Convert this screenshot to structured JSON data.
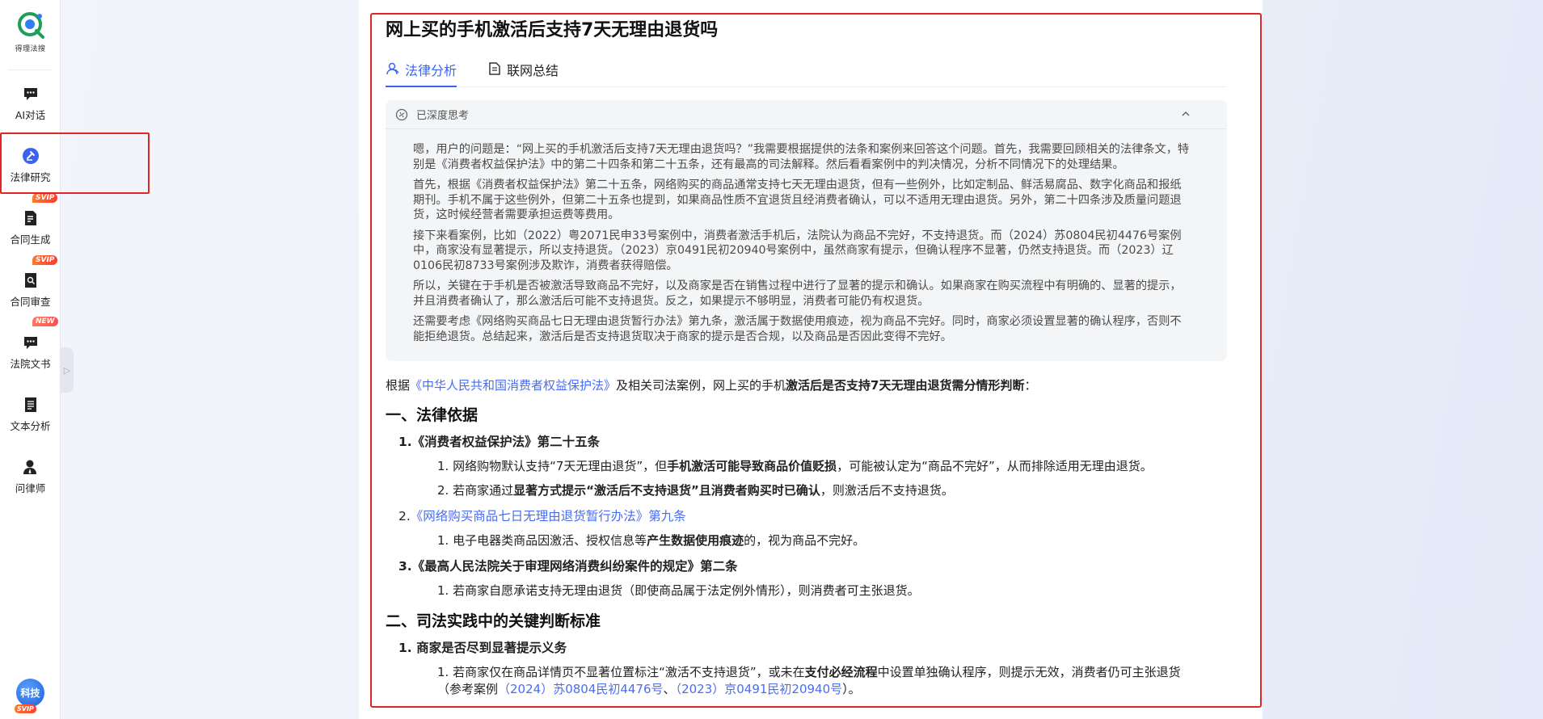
{
  "sidebar": {
    "logo_text": "得理法搜",
    "items": [
      {
        "label": "AI对话",
        "icon": "chat-icon",
        "badge": ""
      },
      {
        "label": "法律研究",
        "icon": "law-research-icon",
        "badge": ""
      },
      {
        "label": "合同生成",
        "icon": "contract-generate-icon",
        "badge": "SVIP"
      },
      {
        "label": "合同审查",
        "icon": "contract-review-icon",
        "badge": "SVIP"
      },
      {
        "label": "法院文书",
        "icon": "court-document-icon",
        "badge": "NEW"
      },
      {
        "label": "文本分析",
        "icon": "text-analysis-icon",
        "badge": ""
      },
      {
        "label": "问律师",
        "icon": "ask-lawyer-icon",
        "badge": ""
      }
    ],
    "avatar_text": "科技",
    "avatar_badge": "SVIP"
  },
  "main": {
    "title": "网上买的手机激活后支持7天无理由退货吗",
    "tabs": [
      {
        "label": "法律分析",
        "active": true
      },
      {
        "label": "联网总结",
        "active": false
      }
    ],
    "thinking": {
      "header": "已深度思考",
      "paragraphs": [
        "嗯，用户的问题是：“网上买的手机激活后支持7天无理由退货吗？”我需要根据提供的法条和案例来回答这个问题。首先，我需要回顾相关的法律条文，特别是《消费者权益保护法》中的第二十四条和第二十五条，还有最高的司法解释。然后看看案例中的判决情况，分析不同情况下的处理结果。",
        "首先，根据《消费者权益保护法》第二十五条，网络购买的商品通常支持七天无理由退货，但有一些例外，比如定制品、鲜活易腐品、数字化商品和报纸期刊。手机不属于这些例外，但第二十五条也提到，如果商品性质不宜退货且经消费者确认，可以不适用无理由退货。另外，第二十四条涉及质量问题退货，这时候经营者需要承担运费等费用。",
        "接下来看案例，比如（2022）粤2071民申33号案例中，消费者激活手机后，法院认为商品不完好，不支持退货。而（2024）苏0804民初4476号案例中，商家没有显著提示，所以支持退货。（2023）京0491民初20940号案例中，虽然商家有提示，但确认程序不显著，仍然支持退货。而（2023）辽0106民初8733号案例涉及欺诈，消费者获得赔偿。",
        "所以，关键在于手机是否被激活导致商品不完好，以及商家是否在销售过程中进行了显著的提示和确认。如果商家在购买流程中有明确的、显著的提示，并且消费者确认了，那么激活后可能不支持退货。反之，如果提示不够明显，消费者可能仍有权退货。",
        "还需要考虑《网络购买商品七日无理由退货暂行办法》第九条，激活属于数据使用痕迹，视为商品不完好。同时，商家必须设置显著的确认程序，否则不能拒绝退货。总结起来，激活后是否支持退货取决于商家的提示是否合规，以及商品是否因此变得不完好。"
      ]
    },
    "answer": {
      "intro_prefix": "根据",
      "intro_link": "《中华人民共和国消费者权益保护法》",
      "intro_mid": "及相关司法案例，网上买的手机",
      "intro_bold": "激活后是否支持7天无理由退货需分情形判断",
      "intro_suffix": "：",
      "section1_title": "一、法律依据",
      "s1_item1_title": "1.《消费者权益保护法》第二十五条",
      "s1_item1_sub1_a": "1. 网络购物默认支持“7天无理由退货”，但",
      "s1_item1_sub1_b": "手机激活可能导致商品价值贬损",
      "s1_item1_sub1_c": "，可能被认定为“商品不完好”，从而排除适用无理由退货。",
      "s1_item1_sub2_a": "2. 若商家通过",
      "s1_item1_sub2_b": "显著方式提示“激活后不支持退货”且消费者购买时已确认",
      "s1_item1_sub2_c": "，则激活后不支持退货。",
      "s1_item2_num": "2.",
      "s1_item2_title": "《网络购买商品七日无理由退货暂行办法》第九条",
      "s1_item2_sub1_a": "1. 电子电器类商品因激活、授权信息等",
      "s1_item2_sub1_b": "产生数据使用痕迹",
      "s1_item2_sub1_c": "的，视为商品不完好。",
      "s1_item3_title": "3.《最高人民法院关于审理网络消费纠纷案件的规定》第二条",
      "s1_item3_sub1": "1. 若商家自愿承诺支持无理由退货（即使商品属于法定例外情形），则消费者可主张退货。",
      "section2_title": "二、司法实践中的关键判断标准",
      "s2_item1_title": "1. 商家是否尽到显著提示义务",
      "s2_item1_sub1_a": "1. 若商家仅在商品详情页不显著位置标注“激活不支持退货”，或未在",
      "s2_item1_sub1_b": "支付必经流程",
      "s2_item1_sub1_c": "中设置单独确认程序，则提示无效，消费者仍可主张退货",
      "s2_item1_sub1_d": "（参考案例",
      "s2_item1_case1": "（2024）苏0804民初4476号",
      "s2_item1_sep": "、",
      "s2_item1_case2": "（2023）京0491民初20940号",
      "s2_item1_end": "）。"
    }
  },
  "colors": {
    "accent": "#3b63f0",
    "highlight_border": "#e32424",
    "badge": "#ff4d2f"
  }
}
